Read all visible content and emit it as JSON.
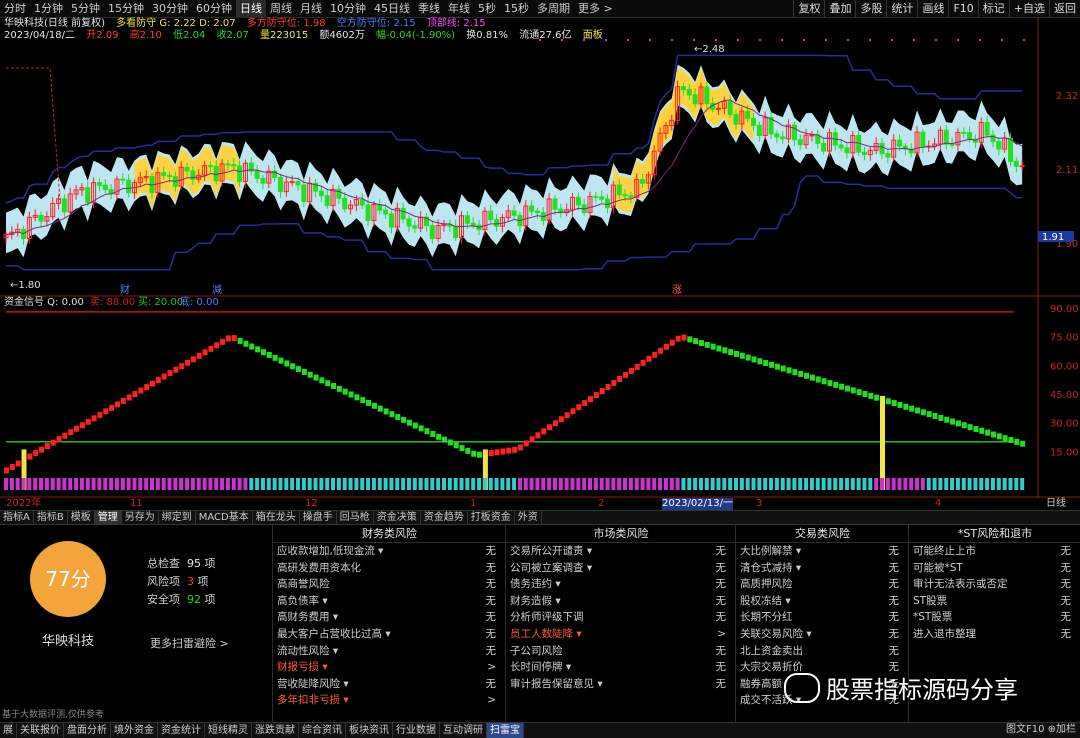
{
  "topbar": {
    "items": [
      "分时",
      "1分钟",
      "5分钟",
      "15分钟",
      "30分钟",
      "60分钟",
      "日线",
      "周线",
      "月线",
      "10分钟",
      "45日线",
      "季线",
      "年线",
      "5秒",
      "15秒",
      "多周期",
      "更多 >"
    ],
    "active": "日线"
  },
  "rightmenu": [
    "复权",
    "叠加",
    "多股",
    "统计",
    "画线",
    "F10",
    "标记",
    "+自选",
    "返回"
  ],
  "info1": {
    "stock": "华映科技(日线 前复权)",
    "indicator": "多看防守 G: 2.22 D: 2.07",
    "extra1": "多方防守位: 1.98",
    "extra2": "空方防守位: 2.15",
    "extra3": "顶部线: 2.15"
  },
  "info2": {
    "date": "2023/04/18/二",
    "open": "开2.09",
    "high": "高2.10",
    "low": "低2.04",
    "close": "收2.07",
    "vol": "量223015",
    "amount": "额4602万",
    "change": "幅-0.04(-1.90%)",
    "turnover": "换0.81%",
    "float": "流通27.6亿",
    "board": "面板"
  },
  "price_axis": [
    "2.32",
    "2.11",
    "1.90"
  ],
  "price_marker": "1.91",
  "annot_high": "2.48",
  "annot_low": "1.80",
  "annot_tags": [
    "财",
    "减",
    "涨"
  ],
  "sub_title": "资金信号 Q: 0.00",
  "sub_vals": {
    "a": "卖: 88.00",
    "b": "买: 20.00",
    "c": "底: 0.00"
  },
  "sub_axis": [
    "90.00",
    "75.00",
    "60.00",
    "45.00",
    "30.00",
    "15.00"
  ],
  "date_axis": [
    "2022年",
    "11",
    "12",
    "1",
    "2",
    "2023/02/13/一",
    "3",
    "4"
  ],
  "axis_right": "日线",
  "toolbar": [
    "指标A",
    "指标B",
    "模板",
    "管理",
    "另存为",
    "绑定到",
    "MACD基本",
    "箱在龙头",
    "操盘手",
    "回马枪",
    "资金决策",
    "资金趋势",
    "打板资金",
    "外资"
  ],
  "toolbar_active": "管理",
  "score": {
    "value": "77分",
    "name": "华映科技",
    "total_label": "总检查",
    "total": "95",
    "total_unit": "项",
    "risk_label": "风险项",
    "risk": "3",
    "risk_unit": "项",
    "safe_label": "安全项",
    "safe": "92",
    "safe_unit": "项",
    "more": "更多扫雷避险 >",
    "note": "基于大数据评测,仅供参考"
  },
  "columns": [
    {
      "title": "财务类风险",
      "rows": [
        [
          "应收款增加,低现金流 ▾",
          "无"
        ],
        [
          "高研发费用资本化",
          "无"
        ],
        [
          "高商誉风险",
          "无"
        ],
        [
          "高负债率 ▾",
          "无"
        ],
        [
          "高财务费用 ▾",
          "无"
        ],
        [
          "最大客户占营收比过高 ▾",
          "无"
        ],
        [
          "流动性风险 ▾",
          "无"
        ],
        [
          "财报亏损 ▾",
          ">"
        ],
        [
          "营收陡降风险 ▾",
          "无"
        ],
        [
          "多年扣非亏损 ▾",
          ">"
        ]
      ],
      "hl": [
        7,
        9
      ]
    },
    {
      "title": "市场类风险",
      "rows": [
        [
          "交易所公开谴责 ▾",
          "无"
        ],
        [
          "公司被立案调查 ▾",
          "无"
        ],
        [
          "债务违约 ▾",
          "无"
        ],
        [
          "财务造假 ▾",
          "无"
        ],
        [
          "分析师评级下调",
          "无"
        ],
        [
          "员工人数陡降 ▾",
          ">"
        ],
        [
          "子公司风险",
          "无"
        ],
        [
          "长时间停牌 ▾",
          "无"
        ],
        [
          "审计报告保留意见 ▾",
          "无"
        ]
      ],
      "hl": [
        5
      ]
    },
    {
      "title": "交易类风险",
      "rows": [
        [
          "大比例解禁 ▾",
          "无"
        ],
        [
          "清仓式减持 ▾",
          "无"
        ],
        [
          "高质押风险",
          "无"
        ],
        [
          "股权冻结 ▾",
          "无"
        ],
        [
          "长期不分红",
          "无"
        ],
        [
          "关联交易风险 ▾",
          "无"
        ],
        [
          "北上资金卖出",
          "无"
        ],
        [
          "大宗交易折价",
          "无"
        ],
        [
          "融券高额",
          "无"
        ],
        [
          "成交不活跃 ▾",
          "无"
        ]
      ],
      "hl": []
    },
    {
      "title": "*ST风险和退市",
      "rows": [
        [
          "可能终止上市",
          "无"
        ],
        [
          "可能被*ST",
          "无"
        ],
        [
          "审计无法表示或否定",
          "无"
        ],
        [
          "ST股票",
          "无"
        ],
        [
          "*ST股票",
          "无"
        ],
        [
          "进入退市整理",
          "无"
        ]
      ],
      "hl": []
    }
  ],
  "bottombar": [
    "展",
    "关联报价",
    "盘面分析",
    "境外资金",
    "资金统计",
    "短线精灵",
    "涨跌贡献",
    "综合资讯",
    "板块资讯",
    "行业数据",
    "互动调研",
    "扫雷宝"
  ],
  "bottombar_active": "扫雷宝",
  "bottom_right": "图文F10 ⊕加栏",
  "watermark": "股票指标源码分享",
  "colors": {
    "up": "#ff2020",
    "down": "#20e020",
    "cloud_light": "#c8f2ff",
    "cloud_warm": "#ffd23a",
    "upper_line": "#2030a0",
    "signal_red": "#d01010",
    "signal_green": "#20c020",
    "strip_magenta": "#cc33cc",
    "strip_cyan": "#33cccc",
    "score": "#f3a43a"
  }
}
